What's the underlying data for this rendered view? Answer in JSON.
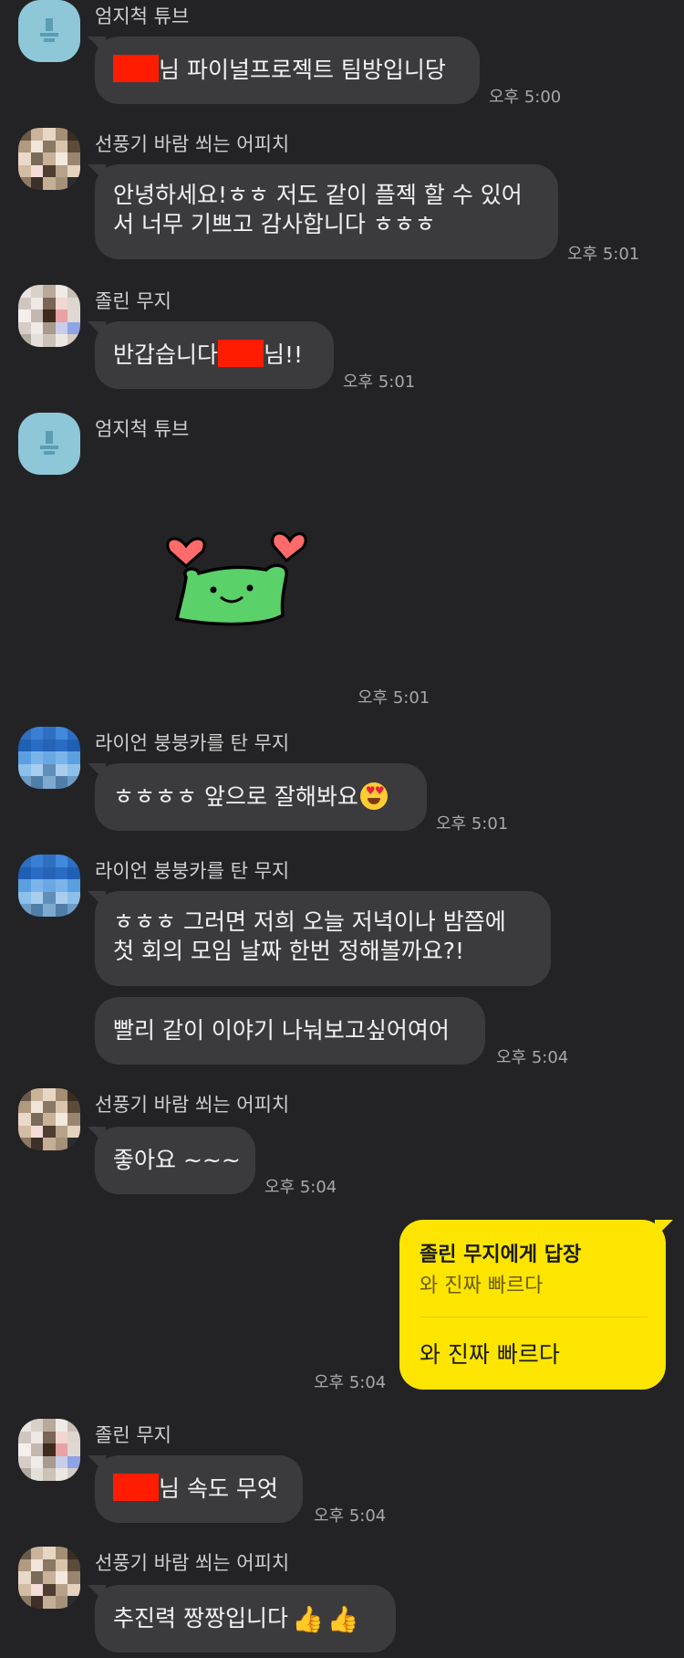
{
  "senders": {
    "tube": "엄지척 튜브",
    "apeach": "선풍기 바람 쐬는 어피치",
    "muzi": "졸린 무지",
    "lion": "라이언 붕붕카를 탄 무지"
  },
  "messages": {
    "m1": {
      "after_redaction": "님 파이널프로젝트 팀방입니당",
      "time": "오후 5:00"
    },
    "m2": {
      "line1": "안녕하세요!ㅎㅎ 저도 같이 플젝 할 수 있어",
      "line2": "서 너무 기쁘고 감사합니다  ㅎㅎㅎ",
      "time": "오후 5:01"
    },
    "m3": {
      "before_redaction": "반갑습니다",
      "after_redaction": "님!!",
      "time": "오후 5:01"
    },
    "m4": {
      "sticker": "frog-hearts-sticker",
      "time": "오후 5:01"
    },
    "m5": {
      "text": "ㅎㅎㅎㅎ 앞으로 잘해봐요",
      "emoji": "heart-eyes-emoji",
      "time": "오후 5:01"
    },
    "m6": {
      "line1": "ㅎㅎㅎ 그러면 저희 오늘 저녁이나 밤쯤에",
      "line2": "첫 회의 모임 날짜 한번 정해볼까요?!"
    },
    "m7": {
      "text": "빨리 같이 이야기 나눠보고싶어여어",
      "time": "오후 5:04"
    },
    "m8": {
      "text": "좋아요 ~~~",
      "time": "오후 5:04"
    },
    "m9": {
      "reply_to": "졸린 무지에게 답장",
      "quoted": "와 진짜 빠르다",
      "text": "와 진짜 빠르다",
      "time": "오후 5:04"
    },
    "m10": {
      "after_redaction": "님 속도 무엇",
      "time": "오후 5:04"
    },
    "m11": {
      "text": "추진력 짱짱입니다",
      "emoji": "thumbs-up-emoji",
      "time": ""
    }
  },
  "colors": {
    "background": "#232325",
    "bubble": "#3b3b3d",
    "my_bubble": "#fee500",
    "redaction": "#ff1c00"
  }
}
